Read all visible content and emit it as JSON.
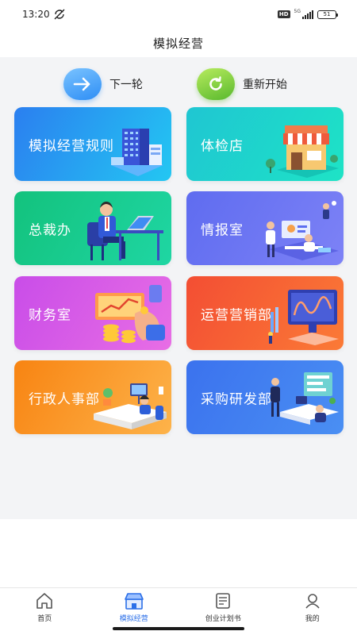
{
  "status": {
    "time": "13:20",
    "hd": "HD",
    "network": "5G",
    "battery": "51"
  },
  "header": {
    "title": "模拟经营"
  },
  "actions": {
    "next_label": "下一轮",
    "restart_label": "重新开始"
  },
  "cards": [
    {
      "label": "模拟经营规则",
      "icon": "office-buildings"
    },
    {
      "label": "体检店",
      "icon": "store-front"
    },
    {
      "label": "总裁办",
      "icon": "ceo-at-laptop"
    },
    {
      "label": "情报室",
      "icon": "people-presentation"
    },
    {
      "label": "财务室",
      "icon": "coins-and-chart"
    },
    {
      "label": "运营营销部",
      "icon": "marketing-screen"
    },
    {
      "label": "行政人事部",
      "icon": "admin-office-desk"
    },
    {
      "label": "采购研发部",
      "icon": "rd-team-desk"
    }
  ],
  "tabbar": {
    "items": [
      {
        "label": "首页",
        "icon": "home-icon",
        "active": false
      },
      {
        "label": "模拟经营",
        "icon": "shop-icon",
        "active": true
      },
      {
        "label": "创业计划书",
        "icon": "document-icon",
        "active": false
      },
      {
        "label": "我的",
        "icon": "user-icon",
        "active": false
      }
    ],
    "active_color": "#2b6fe8"
  }
}
